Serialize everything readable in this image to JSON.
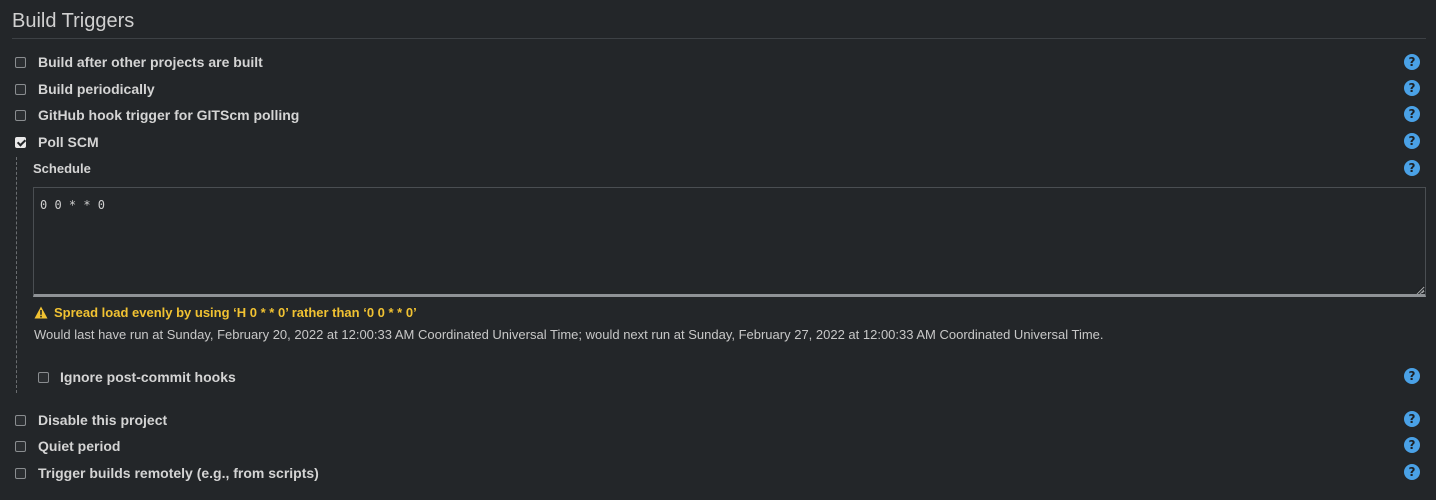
{
  "section": {
    "title": "Build Triggers"
  },
  "triggers": {
    "build_after_other": {
      "label": "Build after other projects are built",
      "checked": false
    },
    "build_periodically": {
      "label": "Build periodically",
      "checked": false
    },
    "github_hook": {
      "label": "GitHub hook trigger for GITScm polling",
      "checked": false
    },
    "poll_scm": {
      "label": "Poll SCM",
      "checked": true
    },
    "disable_project": {
      "label": "Disable this project",
      "checked": false
    },
    "quiet_period": {
      "label": "Quiet period",
      "checked": false
    },
    "trigger_remotely": {
      "label": "Trigger builds remotely (e.g., from scripts)",
      "checked": false
    }
  },
  "poll_scm_config": {
    "schedule_label": "Schedule",
    "schedule_value": "0 0 * * 0",
    "warning": "Spread load evenly by using ‘H 0 * * 0’ rather than ‘0 0 * * 0’",
    "info": "Would last have run at Sunday, February 20, 2022 at 12:00:33 AM Coordinated Universal Time; would next run at Sunday, February 27, 2022 at 12:00:33 AM Coordinated Universal Time.",
    "ignore_hooks": {
      "label": "Ignore post-commit hooks",
      "checked": false
    }
  },
  "help": {
    "glyph": "?"
  },
  "colors": {
    "background": "#232629",
    "help_icon": "#4aa1e6",
    "warning": "#f1c232"
  },
  "icons": {
    "help": "question-circle-icon",
    "warning": "warning-triangle-icon",
    "checkmark": "checkmark-icon"
  }
}
